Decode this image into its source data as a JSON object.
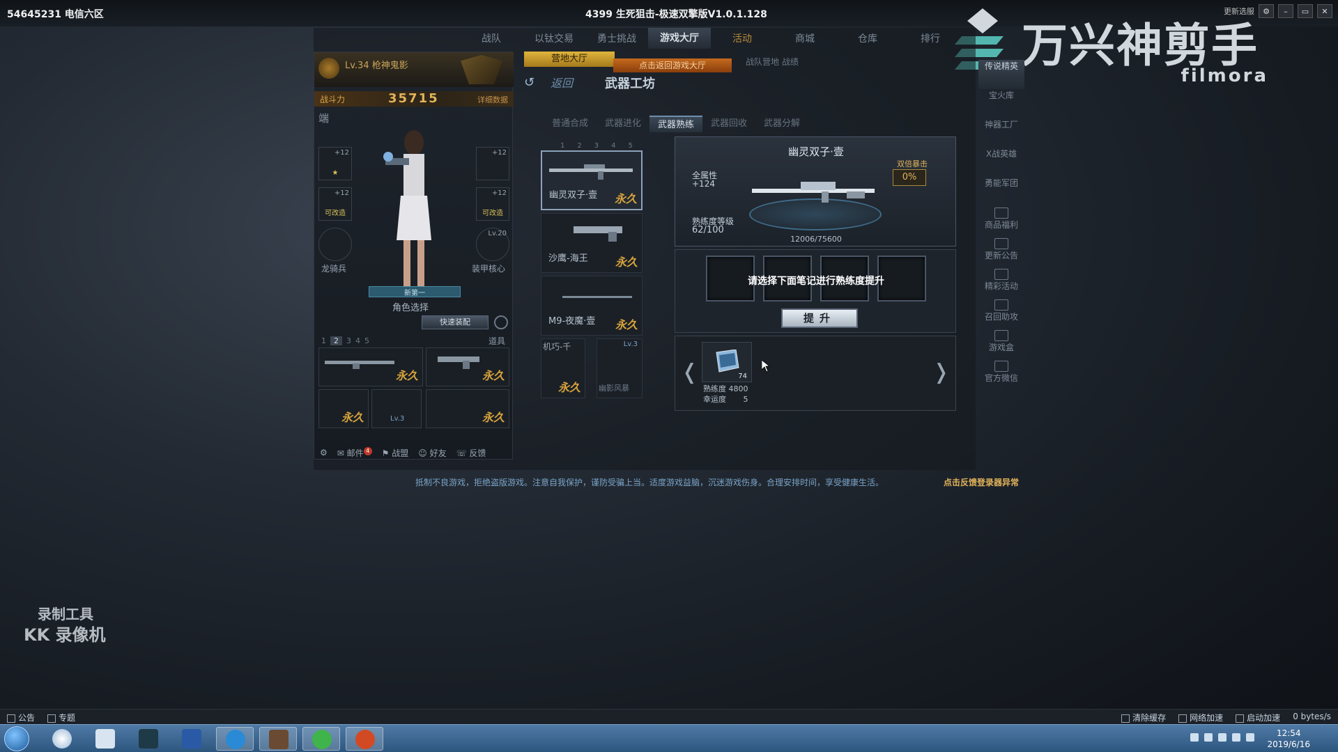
{
  "window": {
    "account": "54645231 电信六区",
    "title": "4399 生死狙击-极速双擎版V1.0.1.128",
    "update_select": "更新选服"
  },
  "watermark": {
    "brand_cn": "万兴神剪手",
    "brand_en": "filmora"
  },
  "nav": {
    "items": [
      "战队",
      "以钛交易",
      "勇士挑战",
      "游戏大厅",
      "活动",
      "商城",
      "仓库",
      "排行"
    ],
    "active": "游戏大厅"
  },
  "character": {
    "level_name": "Lv.34 枪神鬼影",
    "power_label": "战斗力",
    "power_value": "35715",
    "power_detail": "详细数据",
    "end_tag": "端",
    "slots": [
      {
        "level": "+12",
        "tag": ""
      },
      {
        "level": "+12",
        "tag": ""
      },
      {
        "level": "+12",
        "tag": "可改造"
      },
      {
        "level": "+12",
        "tag": "可改造"
      },
      {
        "level": "",
        "tag": ""
      },
      {
        "level": "Lv.20",
        "tag": ""
      }
    ],
    "slot_caption_left": "龙骑兵",
    "slot_caption_right": "装甲核心",
    "role_select_bar": "新第一",
    "role_select": "角色选择",
    "quick_equip": "快速装配",
    "page_numbers": [
      "1",
      "2",
      "3",
      "4",
      "5"
    ],
    "props": "道具",
    "weapon_perm": [
      "永久",
      "永久",
      "永久",
      "永久"
    ],
    "mini_lv": "Lv.3",
    "bottom": {
      "mail": "邮件",
      "mail_count": "4",
      "guild": "战盟",
      "friends": "好友",
      "feedback": "反馈"
    }
  },
  "center": {
    "camp_hall": "营地大厅",
    "return_hint": "点击返回游戏大厅",
    "top_labels": "战队营地          战绩",
    "back": "返回",
    "page_title": "武器工坊",
    "tabs": [
      "普通合成",
      "武器进化",
      "武器熟练",
      "武器回收",
      "武器分解"
    ],
    "active_tab": "武器熟练",
    "pager": [
      "1",
      "2",
      "3",
      "4",
      "5"
    ],
    "weapons": [
      {
        "name": "幽灵双子·壹",
        "perm": "永久"
      },
      {
        "name": "沙鹰-海王",
        "perm": "永久"
      },
      {
        "name": "M9-夜魔·壹",
        "perm": "永久"
      }
    ],
    "mini_weapon": "机巧-千",
    "mini_weapon2": "幽影风暴",
    "mini_lv": "Lv.3",
    "mini_perm": "永久"
  },
  "detail": {
    "weapon_name": "幽灵双子·壹",
    "attr_label": "全属性",
    "attr_value": "+124",
    "double_label": "双倍暴击",
    "double_value": "0%",
    "proficiency_label": "熟练度等级",
    "proficiency_value": "62/100",
    "exp": "12006/75600",
    "hint": "请选择下面笔记进行熟练度提升",
    "upgrade": "提升",
    "note_count": "74",
    "stat_prof_label": "熟练度",
    "stat_prof_value": "4800",
    "stat_luck_label": "幸运度",
    "stat_luck_value": "5"
  },
  "right_menu": [
    "传说精英",
    "宝火库",
    "神器工厂",
    "X战英雄",
    "勇能军团",
    "商品福利",
    "更新公告",
    "精彩活动",
    "召回助攻",
    "游戏盒",
    "官方微信"
  ],
  "notice": {
    "text": "抵制不良游戏，拒绝盗版游戏。注意自我保护，谨防受骗上当。适度游戏益脑，沉迷游戏伤身。合理安排时间，享受健康生活。",
    "link": "点击反馈登录器异常"
  },
  "recorder": {
    "line1": "录制工具",
    "line2": "KK 录像机"
  },
  "status_bar": {
    "left": [
      "公告",
      "专题"
    ],
    "right": [
      "清除缓存",
      "网络加速",
      "启动加速"
    ],
    "speed": "0 bytes/s"
  },
  "taskbar": {
    "time": "12:54",
    "date": "2019/6/16"
  },
  "colors": {
    "accent_gold": "#e2b35a",
    "nav_active": "#d6dde4",
    "taskbar": "#3d6892"
  }
}
